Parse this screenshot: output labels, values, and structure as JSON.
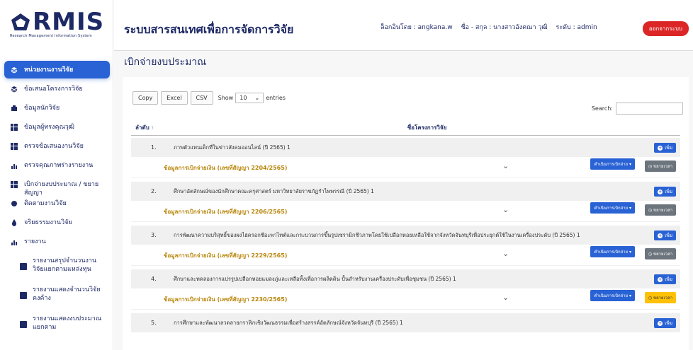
{
  "brand": {
    "logo": "RMIS",
    "subtitle": "Research Management Information System"
  },
  "header": {
    "title": "ระบบสารสนเทศเพื่อการจัดการวิจัย",
    "login_label": "ล็อกอินโดย : angkana.w",
    "name_label": "ชื่อ - สกุล : นางสาวอังคณา วุฒิ",
    "level_label": "ระดับ : admin",
    "logout": "ออกจากระบบ"
  },
  "sidebar": {
    "items": [
      {
        "label": "หน่วยงานงานวิจัย",
        "icon": "layers-icon"
      },
      {
        "label": "ข้อเสนอโครงการวิจัย",
        "icon": "layers-icon"
      },
      {
        "label": "ข้อมูลนักวิจัย",
        "icon": "user-card-icon"
      },
      {
        "label": "ข้อมูลผู้ทรงคุณวุฒิ",
        "icon": "grid-icon"
      },
      {
        "label": "ตรวจข้อเสนองานวิจัย",
        "icon": "grid-icon"
      },
      {
        "label": "ตรวจคุณภาพร่างรายงาน",
        "icon": "bar-chart-icon"
      },
      {
        "label": "เบิกจ่ายงบประมาณ / ขยายสัญญา",
        "icon": "grid-icon"
      },
      {
        "label": "ติดตามงานวิจัย",
        "icon": "circle-icon"
      },
      {
        "label": "จริยธรรมงานวิจัย",
        "icon": "drop-icon"
      },
      {
        "label": "รายงาน",
        "icon": "bar-chart-icon"
      },
      {
        "label": "รายงานสรุปจำนวนงานวิจัยแยกตามแหล่งทุน",
        "icon": "square-icon"
      },
      {
        "label": "รายงานแสดงจำนวนวิจัยคงค้าง",
        "icon": "square-icon"
      },
      {
        "label": "รายงานแสดงงบประมาณแยกตาม",
        "icon": "square-icon"
      }
    ]
  },
  "page": {
    "title": "เบิกจ่ายงบประมาณ"
  },
  "table_controls": {
    "copy": "Copy",
    "excel": "Excel",
    "csv": "CSV",
    "show": "Show",
    "entries_value": "10",
    "entries": "entries",
    "search_label": "Search:"
  },
  "table": {
    "col_no": "ลำดับ",
    "col_name": "ชื่อโครงการวิจัย",
    "add_label": "เพิ่ม",
    "op_label": "ดำเนินการเบิกจ่าย",
    "ext_label": "ขยายเวลา",
    "rows": [
      {
        "no": "1.",
        "title": "ภาพตัวแทนเด็กที่ในข่าวสังคมออนไลน์ (ปี 2565) 1",
        "link": "ข้อมูลการเบิกจ่ายเงิน (เลขที่สัญญา 2204/2565)"
      },
      {
        "no": "2.",
        "title": "ศึกษาอัตลักษณ์ของนักศึกษาคณะครุศาสตร์ มหาวิทยาลัยราชภัฏรำไพพรรณี (ปี 2565) 1",
        "link": "ข้อมูลการเบิกจ่ายเงิน (เลขที่สัญญา 2206/2565)"
      },
      {
        "no": "3.",
        "title": "การพัฒนาความบริสุทธิ์ของผงไฮดรอกซีอะพาไทต์และกระบวนการขึ้นรูปเซรามิกชีวภาพโดยใช้เปลือกหอยเหลือใช้จากจังหวัดจันทบุรีเพื่อประยุกต์ใช้ในงานเครื่องประดับ (ปี 2565) 1",
        "link": "ข้อมูลการเบิกจ่ายเงิน (เลขที่สัญญา 2229/2565)"
      },
      {
        "no": "4.",
        "title": "ศึกษาและทดลองการแปรรูปเปลือกหอยแมลงภู่และเหลือทิ้งเพื่อการผลิตดิน ปั้นสำหรับงานเครื่องประดับเพื่อชุมชน (ปี 2565) 1",
        "link": "ข้อมูลการเบิกจ่ายเงิน (เลขที่สัญญา 2230/2565)"
      },
      {
        "no": "5.",
        "title": "การศึกษาและพัฒนาลวดลายกราฟิกเชิงวัฒนธรรมเพื่อสร้างสรรค์อัตลักษณ์จังหวัดจันทบุรี (ปี 2565) 1",
        "link": ""
      }
    ]
  },
  "colors": {
    "brand": "#1e2a66",
    "accent": "#2962d4",
    "danger": "#dc2626",
    "link": "#b8860b",
    "warning": "#ffc107"
  }
}
